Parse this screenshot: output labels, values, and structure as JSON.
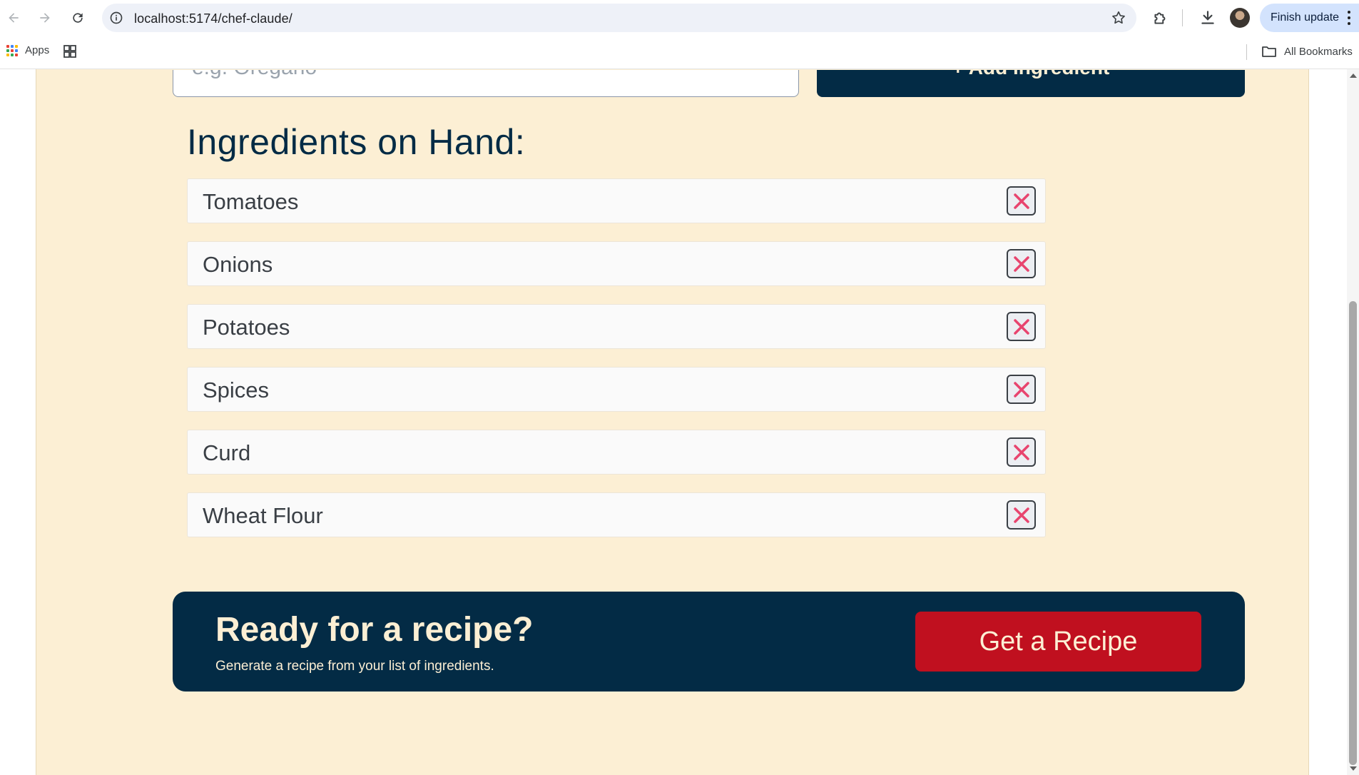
{
  "browser": {
    "url": "localhost:5174/chef-claude/",
    "finish_update_label": "Finish update",
    "bookmarks": {
      "apps_label": "Apps",
      "all_bookmarks_label": "All Bookmarks"
    }
  },
  "form": {
    "input_placeholder": "e.g. Oregano",
    "add_button_label": "+ Add ingredient"
  },
  "ingredients": {
    "title": "Ingredients on Hand:",
    "items": [
      {
        "name": "Tomatoes"
      },
      {
        "name": "Onions"
      },
      {
        "name": "Potatoes"
      },
      {
        "name": "Spices"
      },
      {
        "name": "Curd"
      },
      {
        "name": "Wheat Flour"
      }
    ]
  },
  "cta": {
    "title": "Ready for a recipe?",
    "subtitle": "Generate a recipe from your list of ingredients.",
    "button_label": "Get a Recipe"
  },
  "colors": {
    "background": "#fcefd4",
    "navy": "#032b45",
    "red": "#c0101f",
    "remove_x": "#e8446e"
  }
}
